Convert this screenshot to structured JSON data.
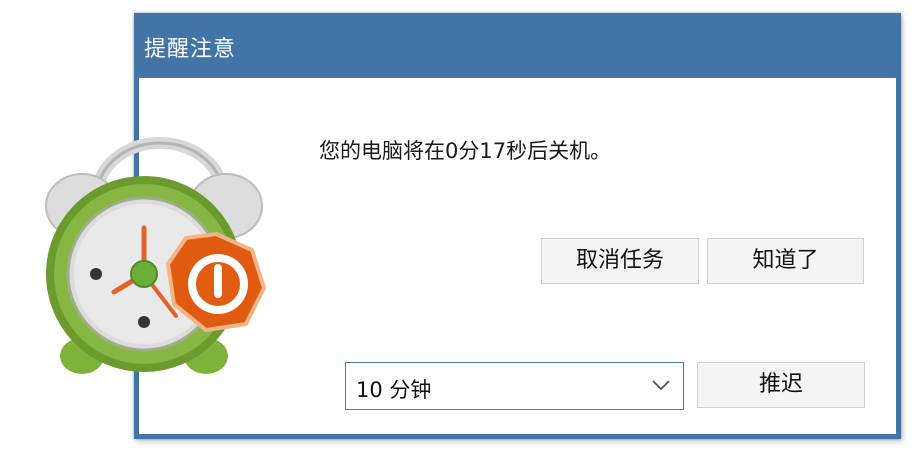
{
  "dialog": {
    "title": "提醒注意",
    "message": "您的电脑将在0分17秒后关机。",
    "buttons": {
      "cancel_task": "取消任务",
      "acknowledge": "知道了",
      "postpone": "推迟"
    },
    "delay_select": {
      "value": "10 分钟"
    }
  },
  "icons": {
    "app": "alarm-clock-icon",
    "badge": "power-icon",
    "dropdown": "chevron-down-icon"
  },
  "colors": {
    "titlebar": "#4274a8",
    "title_text": "#ffffff",
    "button_bg": "#f4f4f4",
    "select_border": "#4a78b8",
    "clock_green": "#6b9a2d",
    "badge_orange": "#e05a10"
  }
}
